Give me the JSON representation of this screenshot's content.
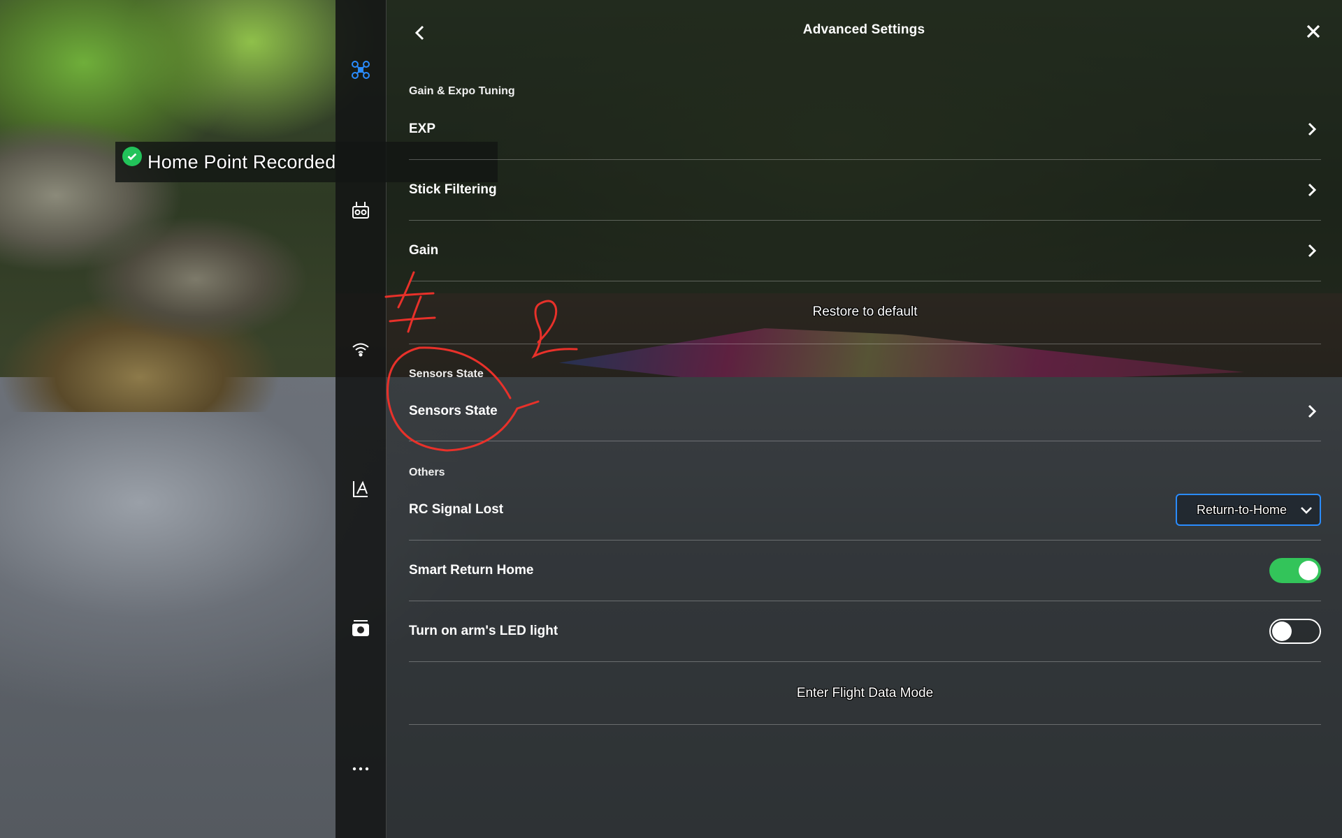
{
  "header": {
    "title": "Advanced Settings",
    "back_icon": "chevron-left-icon",
    "close_icon": "close-icon"
  },
  "toast": {
    "text": "Home Point Recorded",
    "icon": "check-circle-icon",
    "icon_color": "#22c35a"
  },
  "rail": {
    "items": [
      {
        "name": "aircraft-icon",
        "active": true,
        "color": "#2a8cff"
      },
      {
        "name": "remote-controller-icon"
      },
      {
        "name": "wifi-signal-icon"
      },
      {
        "name": "gimbal-icon"
      },
      {
        "name": "camera-icon"
      },
      {
        "name": "more-icon"
      }
    ]
  },
  "sections": {
    "gain_expo": {
      "label": "Gain & Expo Tuning",
      "rows": [
        {
          "label": "EXP"
        },
        {
          "label": "Stick Filtering"
        },
        {
          "label": "Gain"
        }
      ],
      "restore_label": "Restore to default"
    },
    "sensors": {
      "label": "Sensors State",
      "rows": [
        {
          "label": "Sensors State"
        }
      ]
    },
    "others": {
      "label": "Others",
      "rc_signal_lost": {
        "label": "RC Signal Lost",
        "value": "Return-to-Home"
      },
      "smart_return_home": {
        "label": "Smart Return Home",
        "enabled": true
      },
      "arm_led": {
        "label": "Turn on arm's LED light",
        "enabled": false
      },
      "flight_data_label": "Enter Flight Data Mode"
    }
  },
  "colors": {
    "accent": "#2a8cff",
    "toggle_on": "#33c45a",
    "annotation": "#e8312a"
  }
}
